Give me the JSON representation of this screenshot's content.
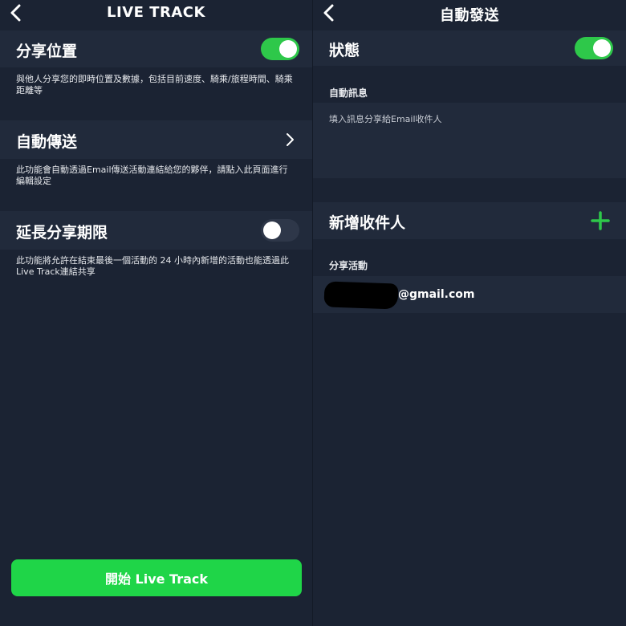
{
  "left": {
    "header": {
      "title": "LIVE TRACK"
    },
    "share_location": {
      "label": "分享位置",
      "enabled": true,
      "description": "與他人分享您的即時位置及數據，包括目前速度、騎乘/旅程時間、騎乘距離等"
    },
    "auto_send": {
      "label": "自動傳送",
      "description": "此功能會自動透過Email傳送活動連結給您的夥伴，請點入此頁面進行編輯設定"
    },
    "extend_sharing": {
      "label": "延長分享期限",
      "enabled": false,
      "description": "此功能將允許在結束最後一個活動的 24 小時內新增的活動也能透過此Live Track連結共享"
    },
    "start_button": {
      "label": "開始 Live Track"
    }
  },
  "right": {
    "header": {
      "title": "自動發送"
    },
    "status": {
      "label": "狀態",
      "enabled": true
    },
    "auto_message": {
      "section_label": "自動訊息",
      "placeholder": "填入訊息分享給Email收件人"
    },
    "add_recipient": {
      "label": "新增收件人"
    },
    "share_activity": {
      "section_label": "分享活動",
      "recipient_email": "@gmail.com"
    }
  },
  "colors": {
    "background": "#1b2333",
    "row": "#212a3b",
    "accent_green": "#2ec84a",
    "button_green": "#1fd548",
    "toggle_off": "#2e3749"
  },
  "icons": {
    "back": "chevron-left-icon",
    "chevron": "chevron-right-icon",
    "add": "plus-icon"
  }
}
